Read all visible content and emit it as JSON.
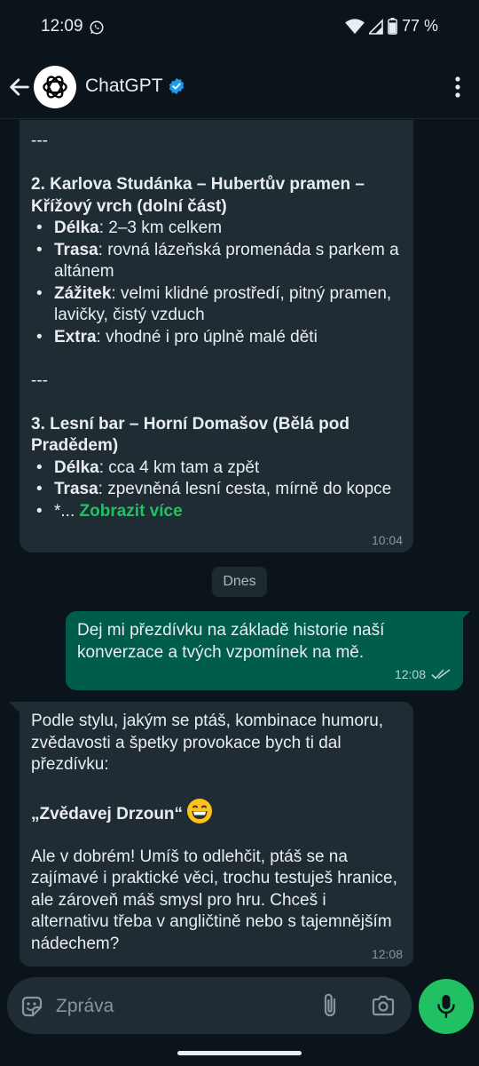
{
  "status_bar": {
    "time": "12:09",
    "battery": "77 %"
  },
  "header": {
    "contact_name": "ChatGPT"
  },
  "messages": {
    "first": {
      "sep1": "---",
      "item2_title": "2. Karlova Studánka – Hubertův pramen – Křížový vrch (dolní část)",
      "item2_points": [
        {
          "label": "Délka",
          "text": ": 2–3 km celkem"
        },
        {
          "label": "Trasa",
          "text": ": rovná lázeňská promenáda s parkem a altánem"
        },
        {
          "label": "Zážitek",
          "text": ": velmi klidné prostředí, pitný pramen, lavičky, čistý vzduch"
        },
        {
          "label": "Extra",
          "text": ": vhodné i pro úplně malé děti"
        }
      ],
      "sep2": "---",
      "item3_title": "3. Lesní bar – Horní Domašov (Bělá pod Pradědem)",
      "item3_points": [
        {
          "label": "Délka",
          "text": ": cca 4 km tam a zpět"
        },
        {
          "label": "Trasa",
          "text": ": zpevněná lesní cesta, mírně do kopce"
        }
      ],
      "truncated_prefix": "*...",
      "show_more": "Zobrazit více",
      "time": "10:04"
    },
    "date_divider": "Dnes",
    "second": {
      "text": "Dej mi přezdívku na základě historie naší konverzace a tvých vzpomínek na mě.",
      "time": "12:08"
    },
    "third": {
      "intro": "Podle stylu, jakým se ptáš, kombinace humoru, zvědavosti a špetky provokace bych ti dal přezdívku:",
      "nickname": "„Zvědavej Drzoun“",
      "body": "Ale v dobrém! Umíš to odlehčit, ptáš se na zajímavé i praktické věci, trochu testuješ hranice, ale zároveň máš smysl pro hru. Chceš i alternativu třeba v angličtině nebo s tajemnějším nádechem?",
      "time": "12:08"
    }
  },
  "input": {
    "placeholder": "Zpráva"
  },
  "colors": {
    "background": "#0b141a",
    "incoming_bubble": "#202c33",
    "outgoing_bubble": "#005c4b",
    "accent_green": "#21c063",
    "verified_blue": "#1d9bf0"
  }
}
